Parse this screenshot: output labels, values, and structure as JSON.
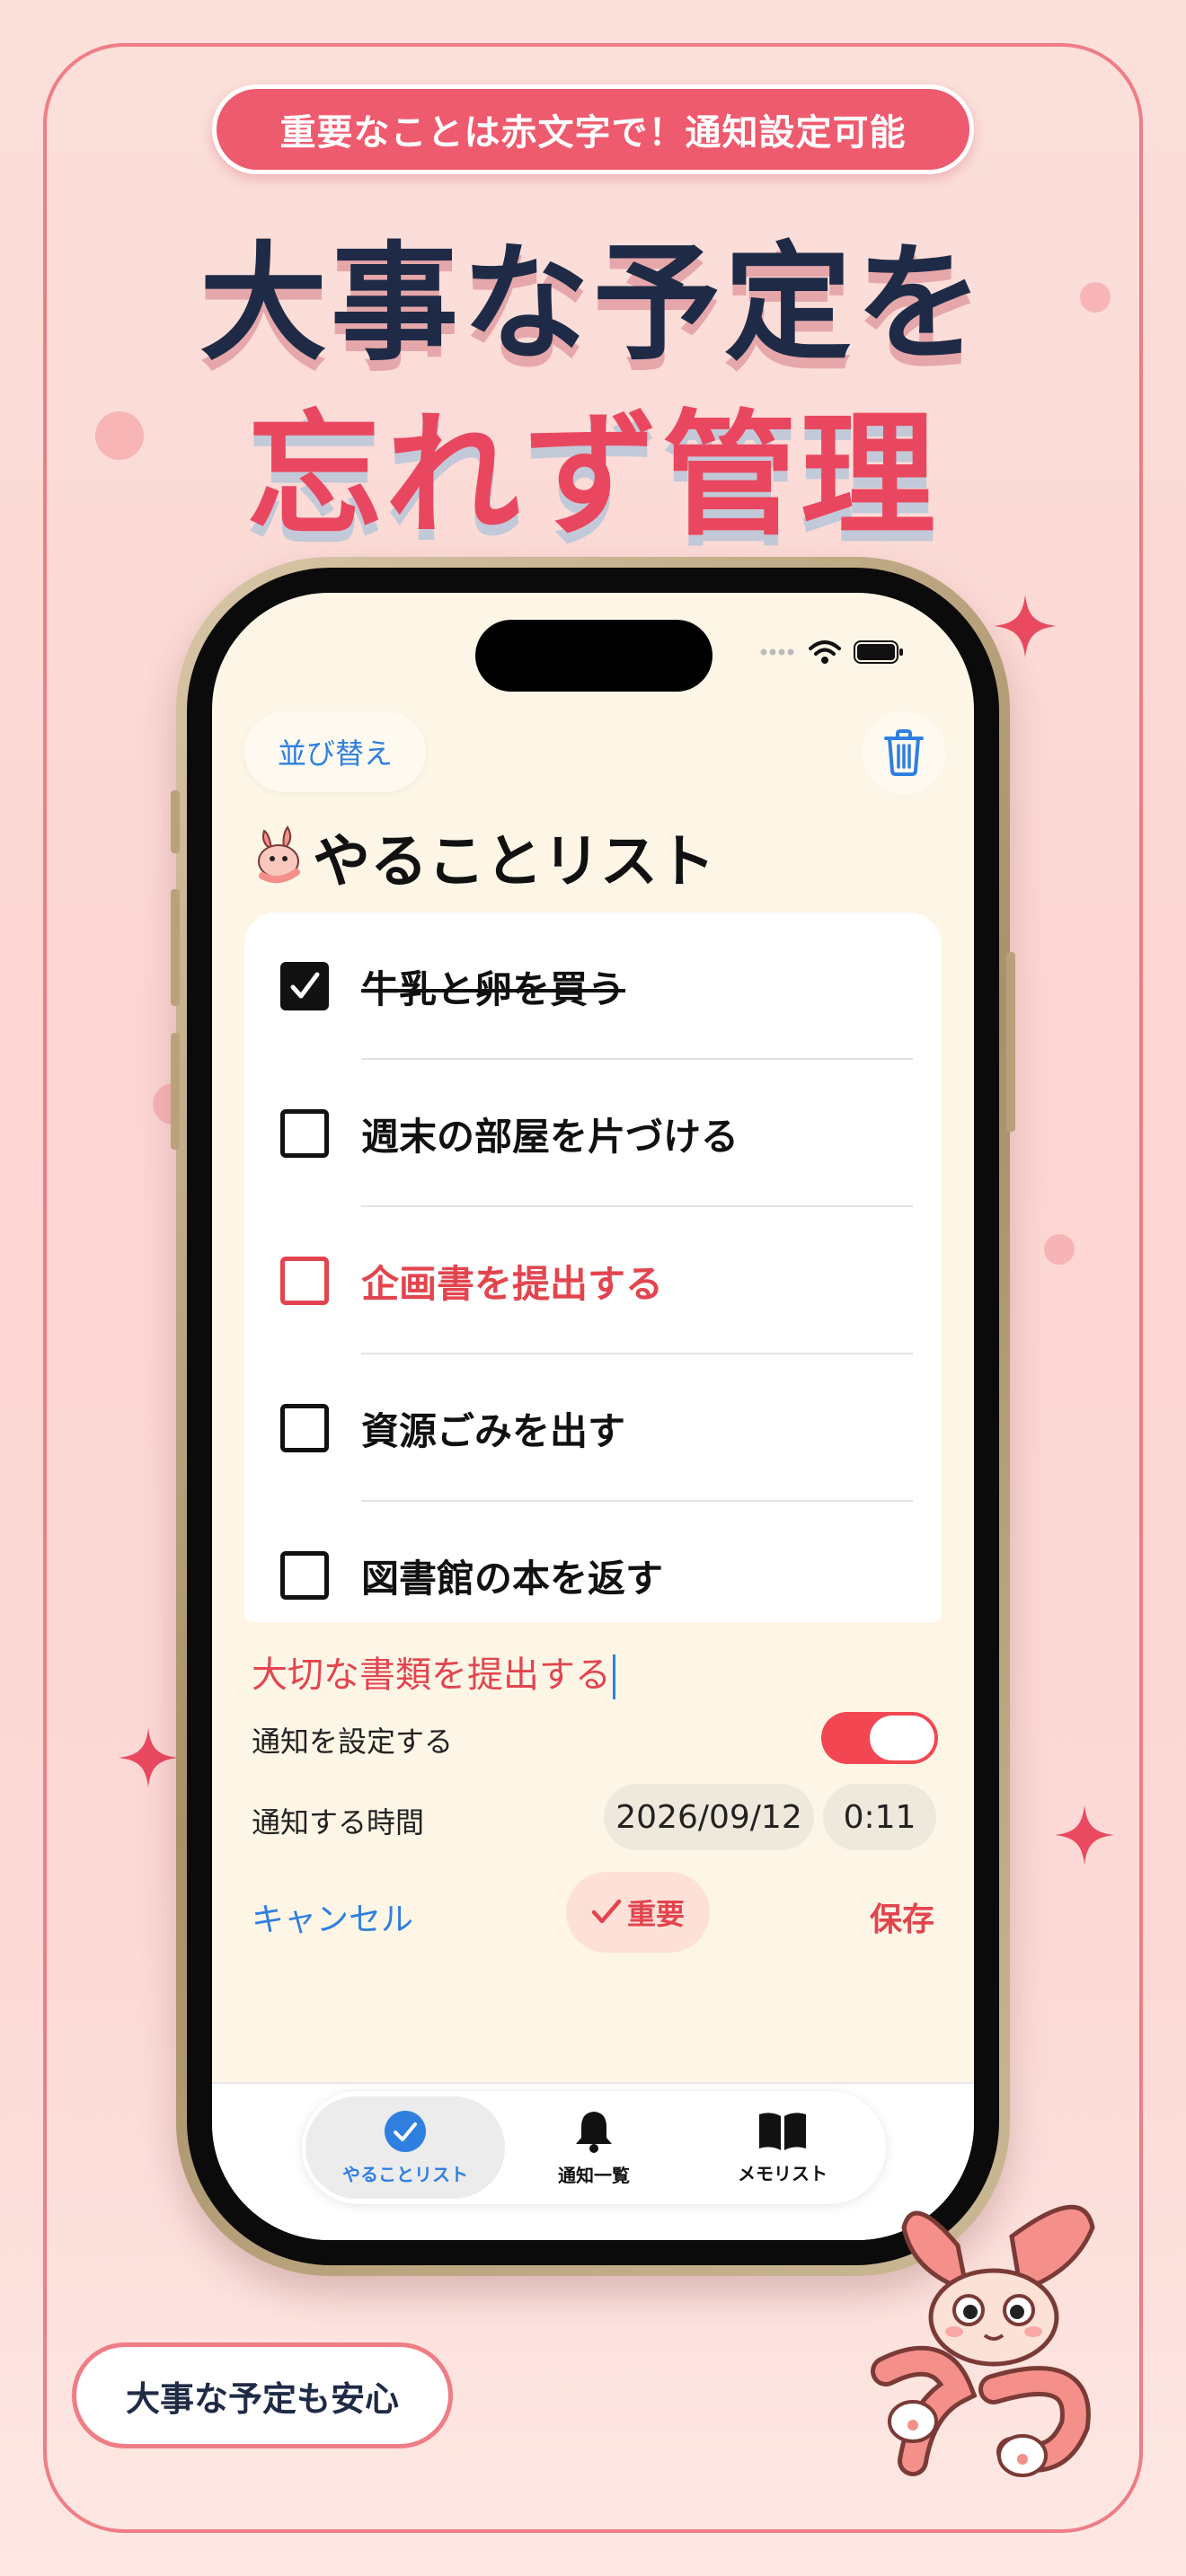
{
  "banner": {
    "tagline": "重要なことは赤文字で！通知設定可能",
    "headline_line1": "大事な予定を",
    "headline_line2": "忘れず管理",
    "bottom_badge": "大事な予定も安心"
  },
  "app": {
    "sort_label": "並び替え",
    "title": "やることリスト",
    "tasks": [
      {
        "label": "牛乳と卵を買う",
        "checked": true,
        "important": false
      },
      {
        "label": "週末の部屋を片づける",
        "checked": false,
        "important": false
      },
      {
        "label": "企画書を提出する",
        "checked": false,
        "important": true
      },
      {
        "label": "資源ごみを出す",
        "checked": false,
        "important": false
      },
      {
        "label": "図書館の本を返す",
        "checked": false,
        "important": false
      }
    ],
    "editor": {
      "input_value": "大切な書類を提出する",
      "notify_label": "通知を設定する",
      "notify_enabled": true,
      "time_label": "通知する時間",
      "date_value": "2026/09/12",
      "time_value": "0:11",
      "cancel_label": "キャンセル",
      "important_label": "重要",
      "save_label": "保存"
    },
    "tabs": [
      {
        "label": "やることリスト",
        "icon": "checkmark-circle-icon",
        "active": true
      },
      {
        "label": "通知一覧",
        "icon": "bell-icon",
        "active": false
      },
      {
        "label": "メモリスト",
        "icon": "book-icon",
        "active": false
      }
    ]
  },
  "colors": {
    "accent_red": "#e2454f",
    "accent_blue": "#2f7fe0",
    "navy": "#1f2b46",
    "pink_banner": "#ee5b6e"
  }
}
